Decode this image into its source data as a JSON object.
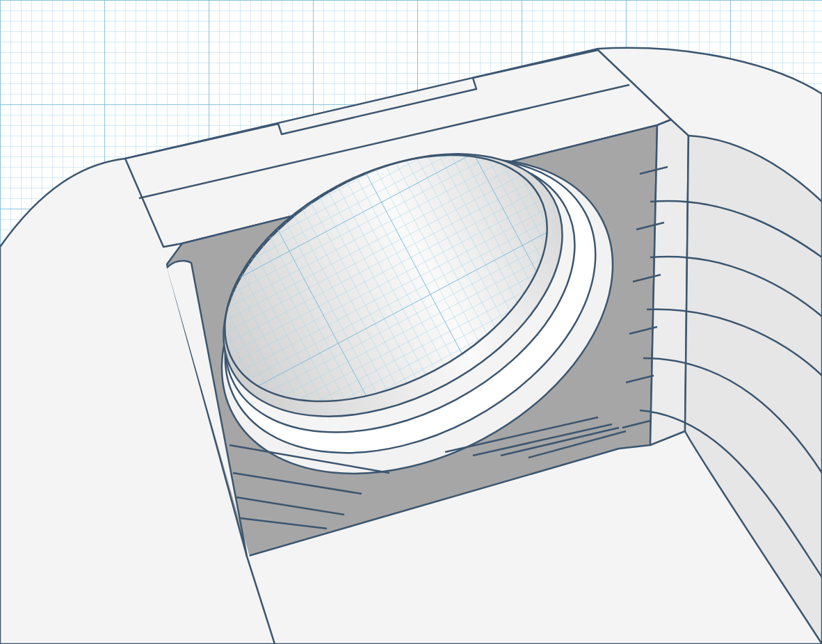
{
  "viewport": {
    "grid": true
  }
}
